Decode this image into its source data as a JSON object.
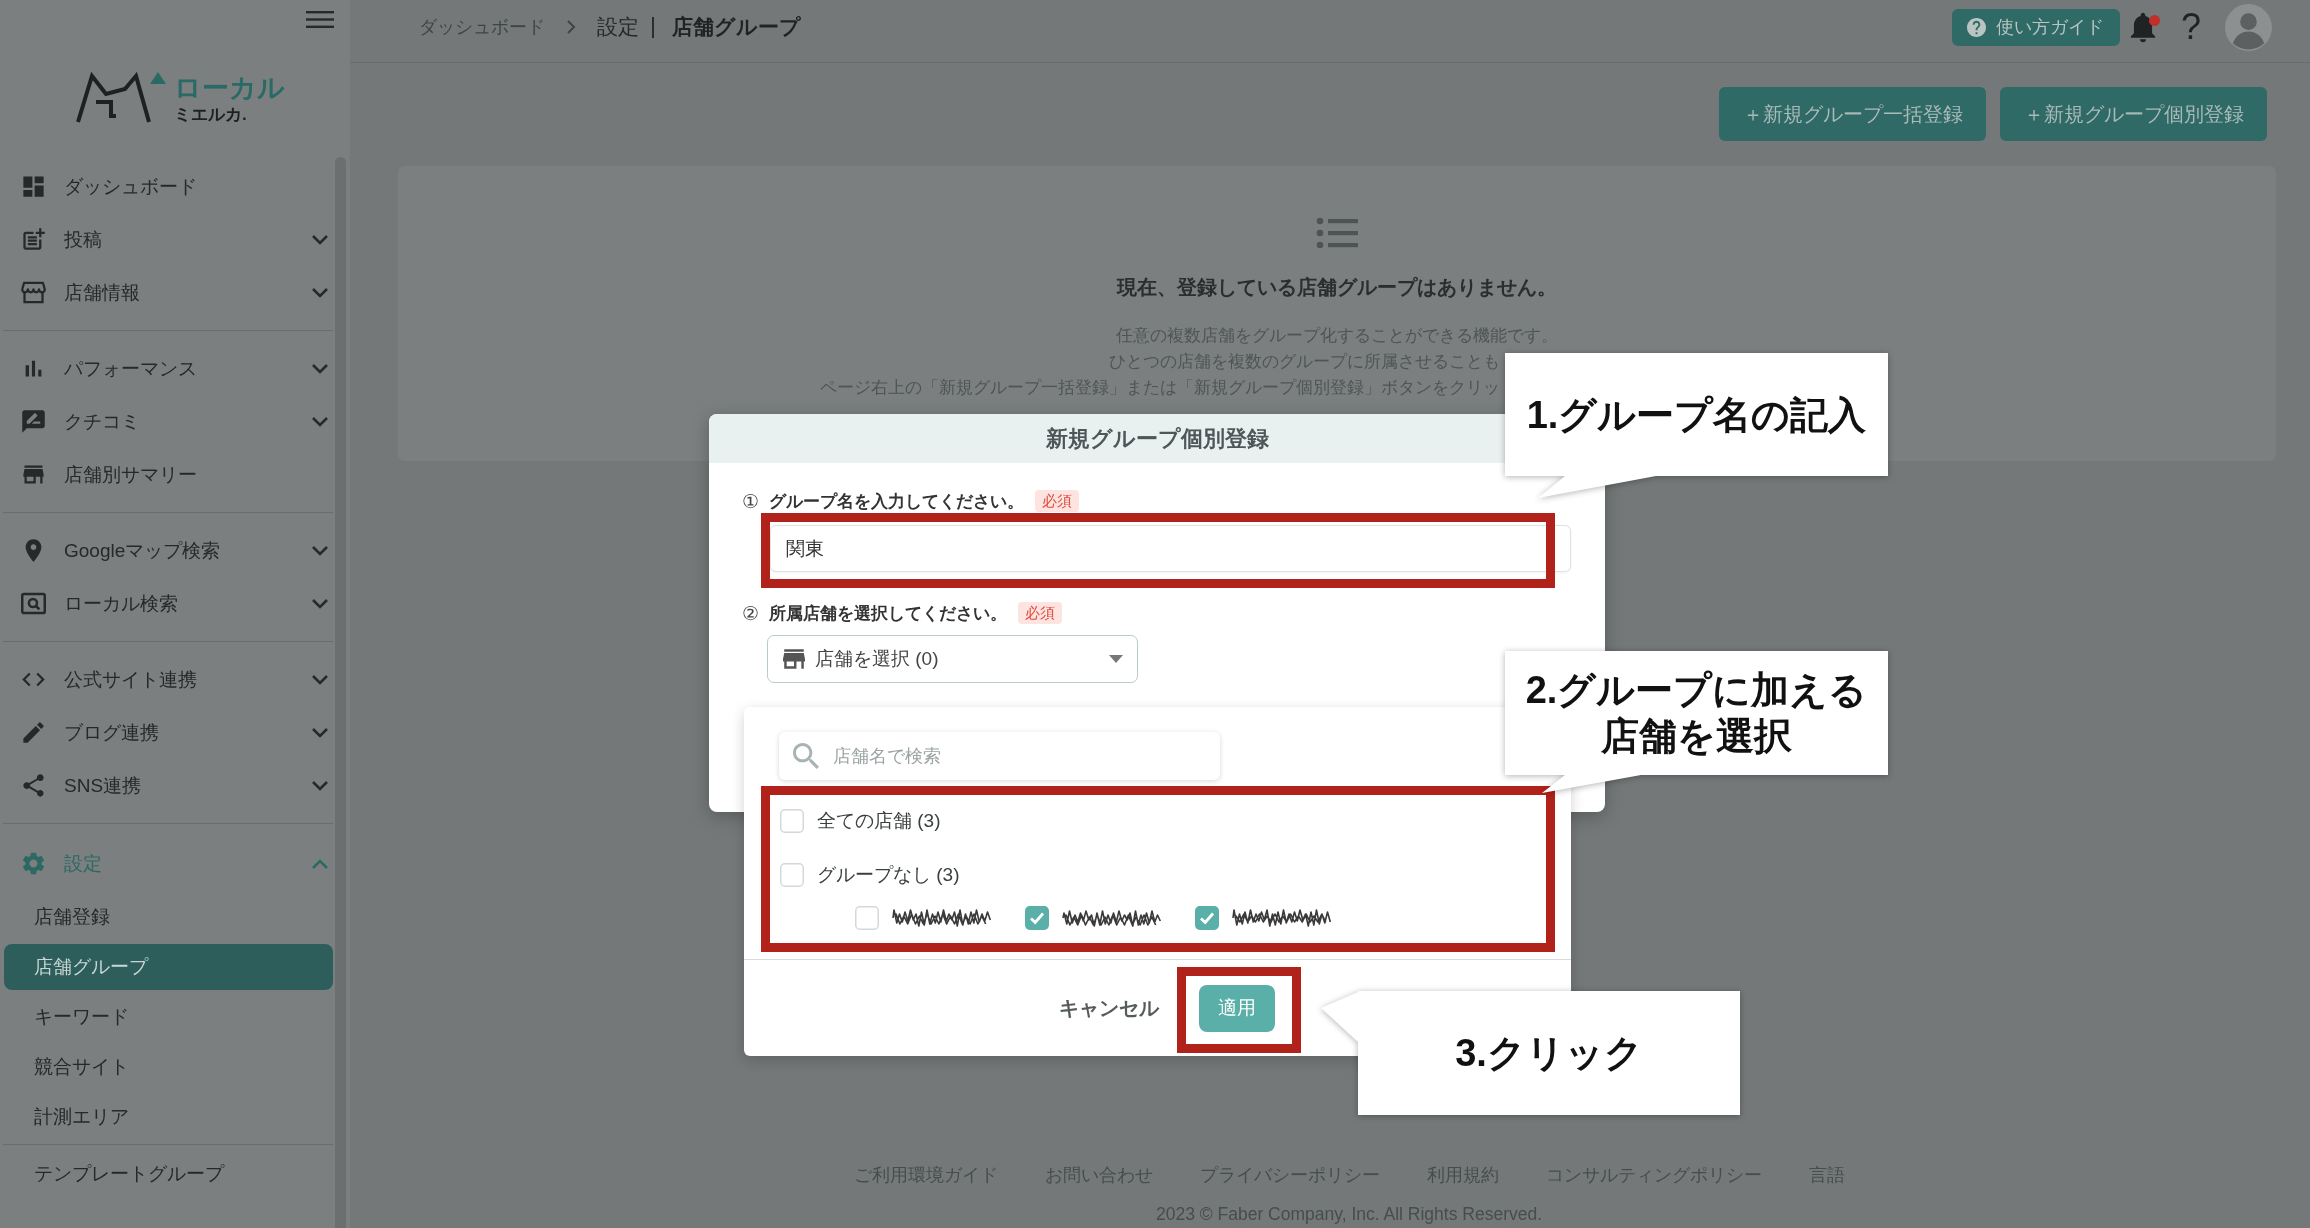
{
  "sidebar": {
    "logo": {
      "title": "ローカル",
      "subtitle": "ミエルカ."
    },
    "sections": [
      {
        "items": [
          {
            "kind": "link",
            "label": "ダッシュボード"
          },
          {
            "kind": "group",
            "label": "投稿",
            "expanded": false
          },
          {
            "kind": "group",
            "label": "店舗情報",
            "expanded": false
          }
        ]
      },
      {
        "items": [
          {
            "kind": "group",
            "label": "パフォーマンス",
            "expanded": false
          },
          {
            "kind": "group",
            "label": "クチコミ",
            "expanded": false
          },
          {
            "kind": "link",
            "label": "店舗別サマリー"
          }
        ]
      },
      {
        "items": [
          {
            "kind": "group",
            "label": "Googleマップ検索",
            "expanded": false
          },
          {
            "kind": "group",
            "label": "ローカル検索",
            "expanded": false
          }
        ]
      },
      {
        "items": [
          {
            "kind": "group",
            "label": "公式サイト連携",
            "expanded": false
          },
          {
            "kind": "group",
            "label": "ブログ連携",
            "expanded": false
          },
          {
            "kind": "group",
            "label": "SNS連携",
            "expanded": false
          }
        ]
      },
      {
        "items": [
          {
            "kind": "group",
            "label": "設定",
            "expanded": true,
            "children": [
              {
                "label": "店舗登録",
                "selected": false
              },
              {
                "label": "店舗グループ",
                "selected": true
              },
              {
                "label": "キーワード",
                "selected": false
              },
              {
                "label": "競合サイト",
                "selected": false
              },
              {
                "label": "計測エリア",
                "selected": false
              }
            ]
          }
        ]
      },
      {
        "items": [
          {
            "kind": "sub",
            "label": "テンプレートグループ",
            "selected": false
          }
        ]
      }
    ]
  },
  "topbar": {
    "breadcrumb": [
      "ダッシュボード"
    ],
    "section": "設定",
    "page_title": "店舗グループ",
    "guide_button": "使い方ガイド",
    "notifications": {
      "unread": true
    },
    "help": "?"
  },
  "actions": [
    "＋新規グループ一括登録",
    "＋新規グループ個別登録"
  ],
  "empty_state": {
    "title": "現在、登録している店舗グループはありません。",
    "lines": [
      "任意の複数店舗をグループ化することができる機能です。",
      "ひとつの店舗を複数のグループに所属させることも",
      "ページ右上の「新規グループ一括登録」または「新規グループ個別登録」ボタンをクリッ"
    ]
  },
  "modal": {
    "title": "新規グループ個別登録",
    "fields": [
      {
        "kind": "text",
        "number": "①",
        "label": "グループ名を入力してください。",
        "badge": "必須",
        "value": "関東",
        "highlighted": true
      },
      {
        "kind": "select",
        "number": "②",
        "label": "所属店舗を選択してください。",
        "badge": "必須",
        "value": "店舗を選択 (0)",
        "expanded": true,
        "dropdown": {
          "search_placeholder": "店舗名で検索",
          "highlighted": true,
          "options": [
            {
              "label": "全ての店舗 (3)",
              "checked": false
            },
            {
              "label": "グループなし (3)",
              "checked": false,
              "children": [
                {
                  "checked": false
                },
                {
                  "checked": true
                },
                {
                  "checked": true
                }
              ]
            }
          ],
          "cancel": "キャンセル",
          "apply": {
            "label": "適用",
            "highlighted": true
          }
        }
      }
    ]
  },
  "callouts": [
    {
      "lines": [
        "1.グループ名の記入"
      ]
    },
    {
      "lines": [
        "2.グループに加える",
        "店舗を選択"
      ]
    },
    {
      "lines": [
        "3.クリック"
      ]
    }
  ],
  "footer": {
    "links": [
      "ご利用環境ガイド",
      "お問い合わせ",
      "プライバシーポリシー",
      "利用規約",
      "コンサルティングポリシー",
      "言語"
    ],
    "copyright": "2023 © Faber Company, Inc. All Rights Reserved."
  }
}
